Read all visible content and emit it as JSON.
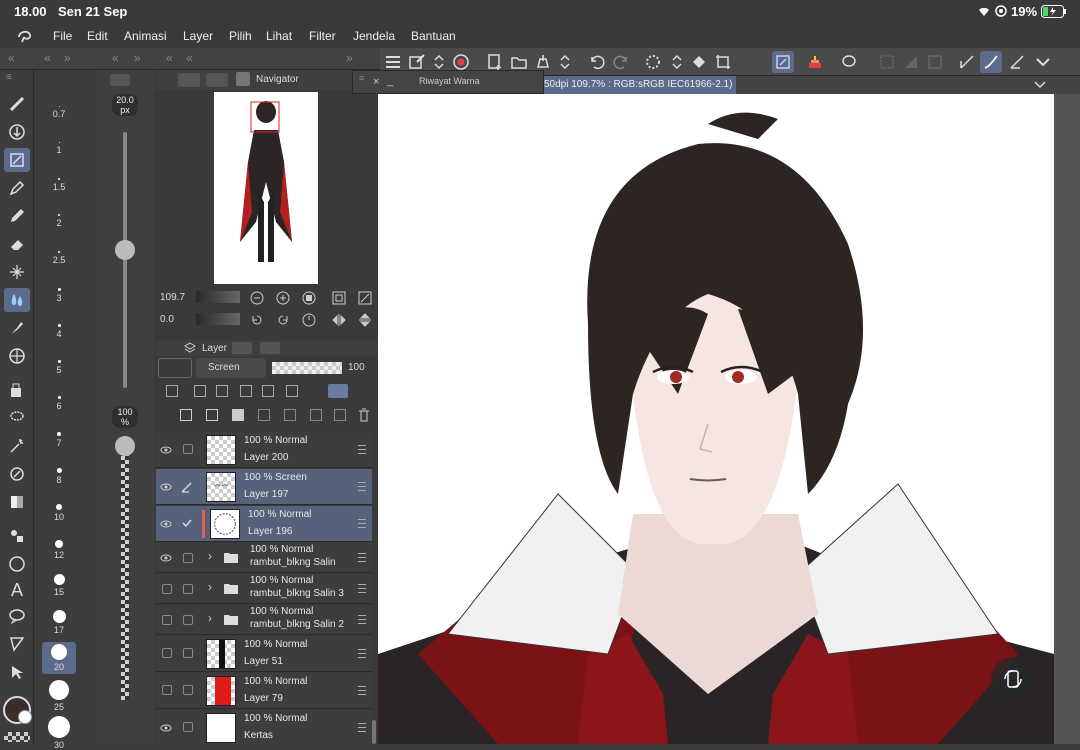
{
  "status": {
    "time": "18.00",
    "date": "Sen 21 Sep",
    "battery": "19%"
  },
  "menu": [
    "File",
    "Edit",
    "Animasi",
    "Layer",
    "Pilih",
    "Lihat",
    "Filter",
    "Jendela",
    "Bantuan"
  ],
  "history_panel": {
    "title": "Riwayat Warna"
  },
  "canvas_info": "50dpi 109.7% : RGB:sRGB IEC61966-2.1)",
  "navigator": {
    "title": "Navigator",
    "zoom": "109.7",
    "rotation": "0.0"
  },
  "brush": {
    "size_value": "20.0",
    "size_unit": "px",
    "opacity_value": "100",
    "opacity_unit": "%"
  },
  "brush_sizes": [
    "0.7",
    "1",
    "1.5",
    "2",
    "2.5",
    "3",
    "4",
    "5",
    "6",
    "7",
    "8",
    "10",
    "12",
    "15",
    "17",
    "20",
    "25",
    "30"
  ],
  "layer_panel": {
    "title": "Layer",
    "blend_mode": "Screen",
    "opacity": "100",
    "layers": [
      {
        "opacity_mode": "100 % Normal",
        "name": "Layer 200",
        "visible": true,
        "selected": false,
        "folder": false,
        "thumb": "blank"
      },
      {
        "opacity_mode": "100 % Screen",
        "name": "Layer 197",
        "visible": true,
        "selected": true,
        "folder": false,
        "thumb": "face"
      },
      {
        "opacity_mode": "100 % Normal",
        "name": "Layer 196",
        "visible": true,
        "selected": true,
        "folder": false,
        "thumb": "face-line"
      },
      {
        "opacity_mode": "100 % Normal",
        "name": "rambut_blkng Salin",
        "visible": true,
        "selected": false,
        "folder": true,
        "thumb": "folder"
      },
      {
        "opacity_mode": "100 % Normal",
        "name": "rambut_blkng Salin 3",
        "visible": false,
        "selected": false,
        "folder": true,
        "thumb": "folder"
      },
      {
        "opacity_mode": "100 % Normal",
        "name": "rambut_blkng Salin 2",
        "visible": false,
        "selected": false,
        "folder": true,
        "thumb": "folder"
      },
      {
        "opacity_mode": "100 % Normal",
        "name": "Layer 51",
        "visible": false,
        "selected": false,
        "folder": false,
        "thumb": "black"
      },
      {
        "opacity_mode": "100 % Normal",
        "name": "Layer 79",
        "visible": false,
        "selected": false,
        "folder": false,
        "thumb": "red"
      },
      {
        "opacity_mode": "100 % Normal",
        "name": "Kertas",
        "visible": true,
        "selected": false,
        "folder": false,
        "thumb": "white"
      }
    ]
  },
  "colors": {
    "accent": "#5a6b8c",
    "selected_layer": "#56617a",
    "main_color": "#3a2e2a"
  }
}
